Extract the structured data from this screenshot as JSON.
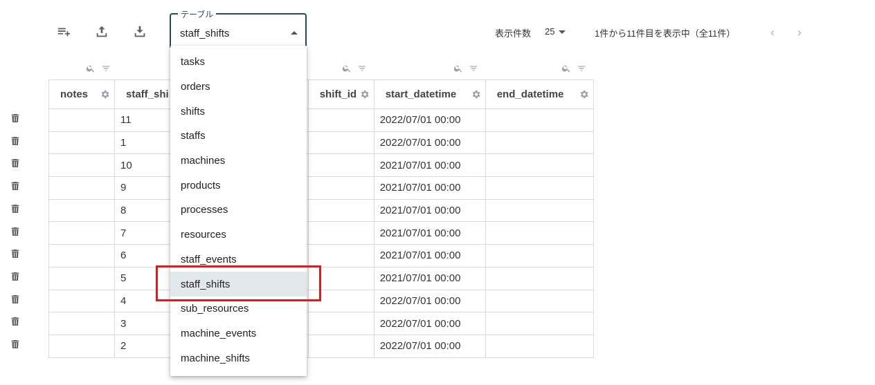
{
  "toolbar": {
    "add_row_icon": "playlist-add-icon",
    "upload_icon": "upload-icon",
    "download_icon": "download-icon"
  },
  "table_select": {
    "legend": "テーブル",
    "value": "staff_shifts"
  },
  "pager": {
    "label": "表示件数",
    "page_size": "25",
    "info": "1件から11件目を表示中（全11件）",
    "prev": "‹",
    "next": "›"
  },
  "columns": [
    {
      "label": "notes"
    },
    {
      "label": "staff_shi"
    },
    {
      "label": ""
    },
    {
      "label": "shift_id"
    },
    {
      "label": "start_datetime"
    },
    {
      "label": "end_datetime"
    }
  ],
  "rows": [
    {
      "notes": "",
      "staff": "11",
      "shift": "",
      "start": "2022/07/01 00:00",
      "end": ""
    },
    {
      "notes": "",
      "staff": "1",
      "shift": "",
      "start": "2022/07/01 00:00",
      "end": ""
    },
    {
      "notes": "",
      "staff": "10",
      "shift": "",
      "start": "2021/07/01 00:00",
      "end": ""
    },
    {
      "notes": "",
      "staff": "9",
      "shift": "",
      "start": "2021/07/01 00:00",
      "end": ""
    },
    {
      "notes": "",
      "staff": "8",
      "shift": "",
      "start": "2021/07/01 00:00",
      "end": ""
    },
    {
      "notes": "",
      "staff": "7",
      "shift": "",
      "start": "2021/07/01 00:00",
      "end": ""
    },
    {
      "notes": "",
      "staff": "6",
      "shift": "",
      "start": "2021/07/01 00:00",
      "end": ""
    },
    {
      "notes": "",
      "staff": "5",
      "shift": "",
      "start": "2021/07/01 00:00",
      "end": ""
    },
    {
      "notes": "",
      "staff": "4",
      "shift": "",
      "start": "2022/07/01 00:00",
      "end": ""
    },
    {
      "notes": "",
      "staff": "3",
      "shift": "",
      "start": "2022/07/01 00:00",
      "end": ""
    },
    {
      "notes": "",
      "staff": "2",
      "shift": "",
      "start": "2022/07/01 00:00",
      "end": ""
    }
  ],
  "dropdown": {
    "selected": "staff_shifts",
    "options": [
      "tasks",
      "orders",
      "shifts",
      "staffs",
      "machines",
      "products",
      "processes",
      "resources",
      "staff_events",
      "staff_shifts",
      "sub_resources",
      "machine_events",
      "machine_shifts"
    ]
  },
  "colors": {
    "accent": "#1e4a63",
    "highlight": "#e0191f",
    "selected_bg": "#e3e8eb"
  }
}
